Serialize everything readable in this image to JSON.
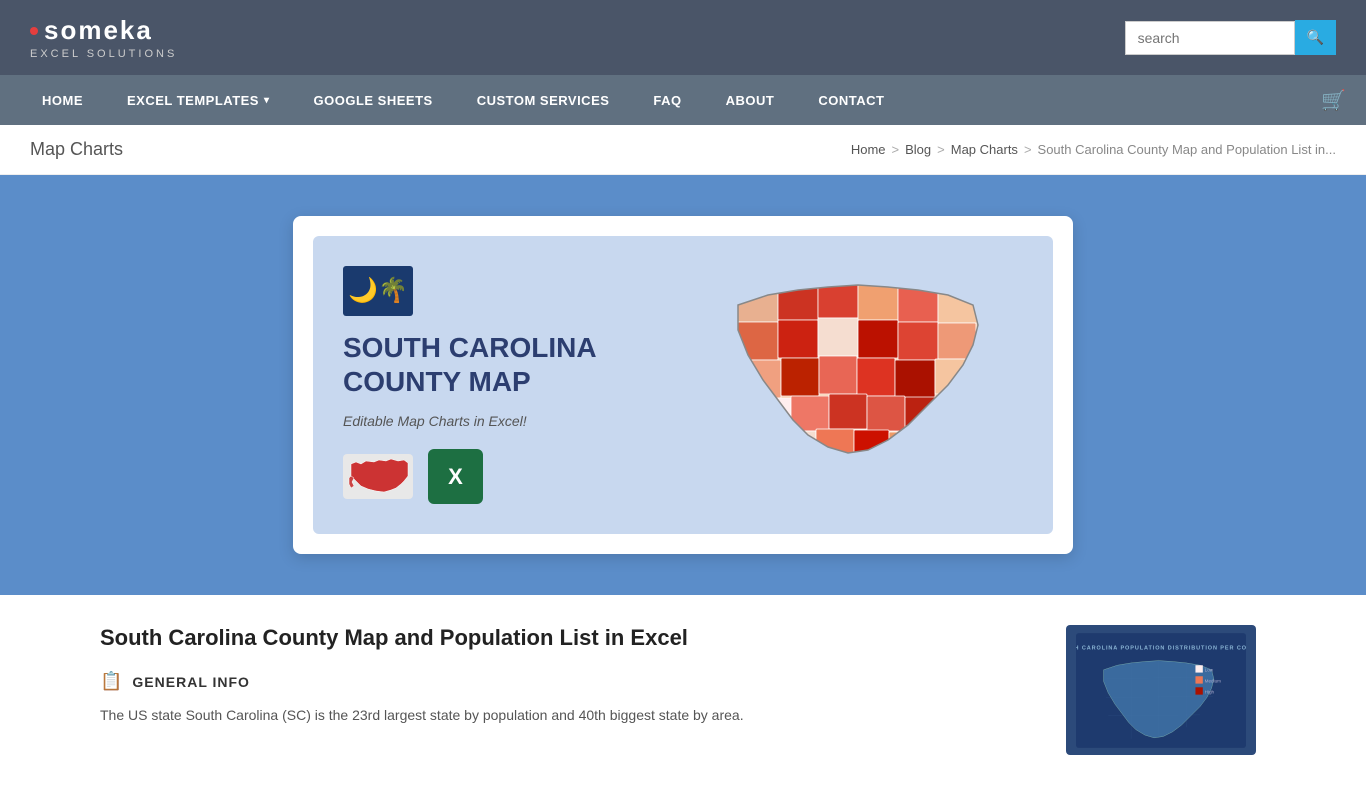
{
  "brand": {
    "name": "someka",
    "tagline": "Excel Solutions",
    "dot_color": "#e53e3e"
  },
  "header": {
    "search_placeholder": "search",
    "search_btn_label": "🔍"
  },
  "nav": {
    "items": [
      {
        "label": "HOME",
        "has_dropdown": false
      },
      {
        "label": "EXCEL TEMPLATES",
        "has_dropdown": true
      },
      {
        "label": "GOOGLE SHEETS",
        "has_dropdown": false
      },
      {
        "label": "CUSTOM SERVICES",
        "has_dropdown": false
      },
      {
        "label": "FAQ",
        "has_dropdown": false
      },
      {
        "label": "ABOUT",
        "has_dropdown": false
      },
      {
        "label": "CONTACT",
        "has_dropdown": false
      }
    ]
  },
  "breadcrumb_bar": {
    "page_title": "Map Charts",
    "breadcrumbs": [
      {
        "label": "Home",
        "link": true
      },
      {
        "label": "Blog",
        "link": true
      },
      {
        "label": "Map Charts",
        "link": true
      },
      {
        "label": "South Carolina County Map and Population List in...",
        "link": false
      }
    ]
  },
  "article": {
    "title": "South Carolina County Map and Population List in Excel",
    "section_label": "GENERAL INFO",
    "body_text": "The US state South Carolina (SC) is the 23rd largest state by population and 40th biggest state by area."
  },
  "hero": {
    "flag_emoji": "🌙🌴",
    "map_title_line1": "SOUTH CAROLINA",
    "map_title_line2": "COUNTY MAP",
    "subtitle": "Editable Map Charts in Excel!",
    "excel_label": "X"
  }
}
